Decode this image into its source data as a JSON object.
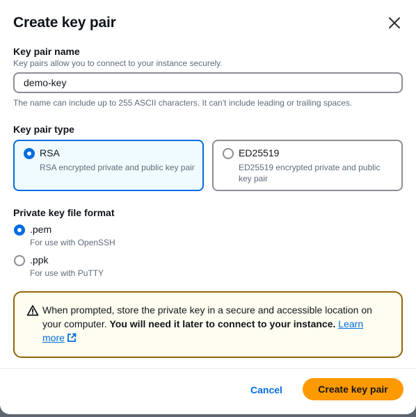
{
  "modal": {
    "title": "Create key pair"
  },
  "key_name": {
    "label": "Key pair name",
    "description": "Key pairs allow you to connect to your instance securely.",
    "value": "demo-key",
    "constraint": "The name can include up to 255 ASCII characters. It can't include leading or trailing spaces."
  },
  "key_type": {
    "label": "Key pair type",
    "options": [
      {
        "title": "RSA",
        "description": "RSA encrypted private and public key pair",
        "selected": true
      },
      {
        "title": "ED25519",
        "description": "ED25519 encrypted private and public key pair",
        "selected": false
      }
    ]
  },
  "file_format": {
    "label": "Private key file format",
    "options": [
      {
        "title": ".pem",
        "description": "For use with OpenSSH",
        "selected": true
      },
      {
        "title": ".ppk",
        "description": "For use with PuTTY",
        "selected": false
      }
    ]
  },
  "alert": {
    "text_before": "When prompted, store the private key in a secure and accessible location on your computer. ",
    "text_bold": "You will need it later to connect to your instance.",
    "link_text": "Learn more",
    "border_color": "#8d6605"
  },
  "footer": {
    "cancel_label": "Cancel",
    "create_label": "Create key pair"
  },
  "colors": {
    "accent": "#006ce0",
    "primary_button": "#ff9900"
  },
  "icons": {
    "close": "close-icon",
    "warning": "warning-icon",
    "external": "external-link-icon"
  }
}
